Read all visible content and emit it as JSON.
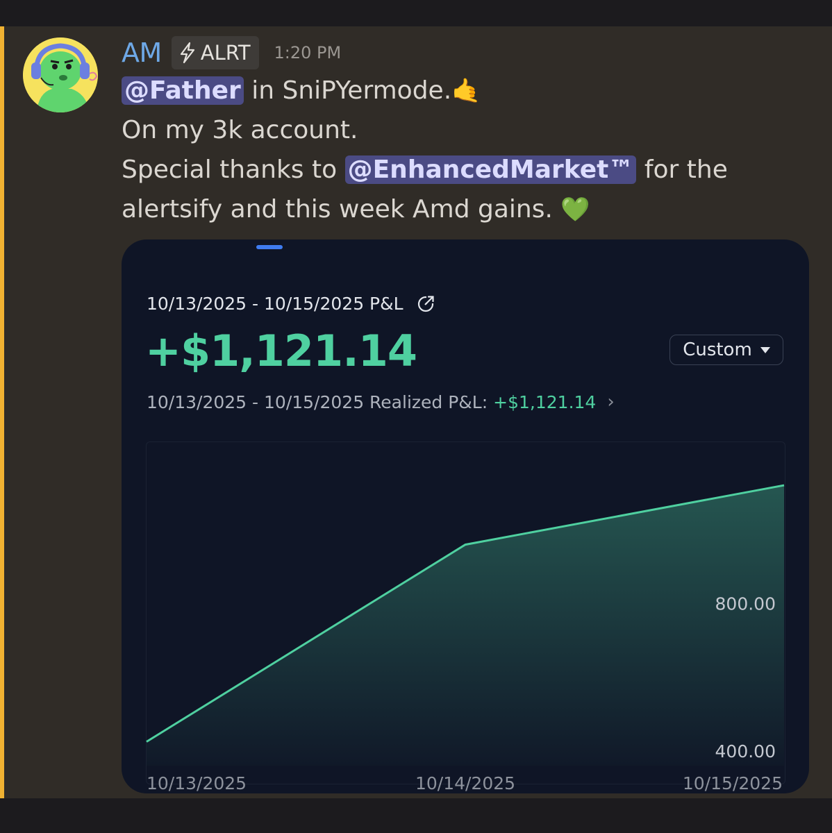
{
  "message": {
    "username": "AM",
    "tag_label": "ALRT",
    "tag_icon": "lightning-icon",
    "timestamp": "1:20 PM",
    "mention_color": "#f0b232",
    "line1": {
      "mention": "@Father",
      "text": " in SniPYermode.",
      "emoji": "🤙"
    },
    "line2": "On my 3k account.",
    "line3": {
      "before": "Special thanks to ",
      "mention": "@EnhancedMarket™",
      "after": " for the"
    },
    "line4": {
      "text": "alertsify and this week Amd gains. ",
      "emoji": "💚"
    }
  },
  "card": {
    "range_title": "10/13/2025 - 10/15/2025 P&L",
    "share_icon": "share-icon",
    "pnl_value": "+$1,121.14",
    "period_select": "Custom",
    "realized_label": "10/13/2025 - 10/15/2025 Realized P&L:",
    "realized_value": "+$1,121.14",
    "accent_color": "#4fd0a0"
  },
  "chart_data": {
    "type": "area",
    "x": [
      "10/13/2025",
      "10/14/2025",
      "10/15/2025"
    ],
    "values": [
      425,
      960,
      1121.14
    ],
    "y_ticks": [
      "400.00",
      "800.00"
    ],
    "ylim": [
      360,
      1240
    ],
    "grid": false,
    "line_color": "#4fd0a0"
  }
}
